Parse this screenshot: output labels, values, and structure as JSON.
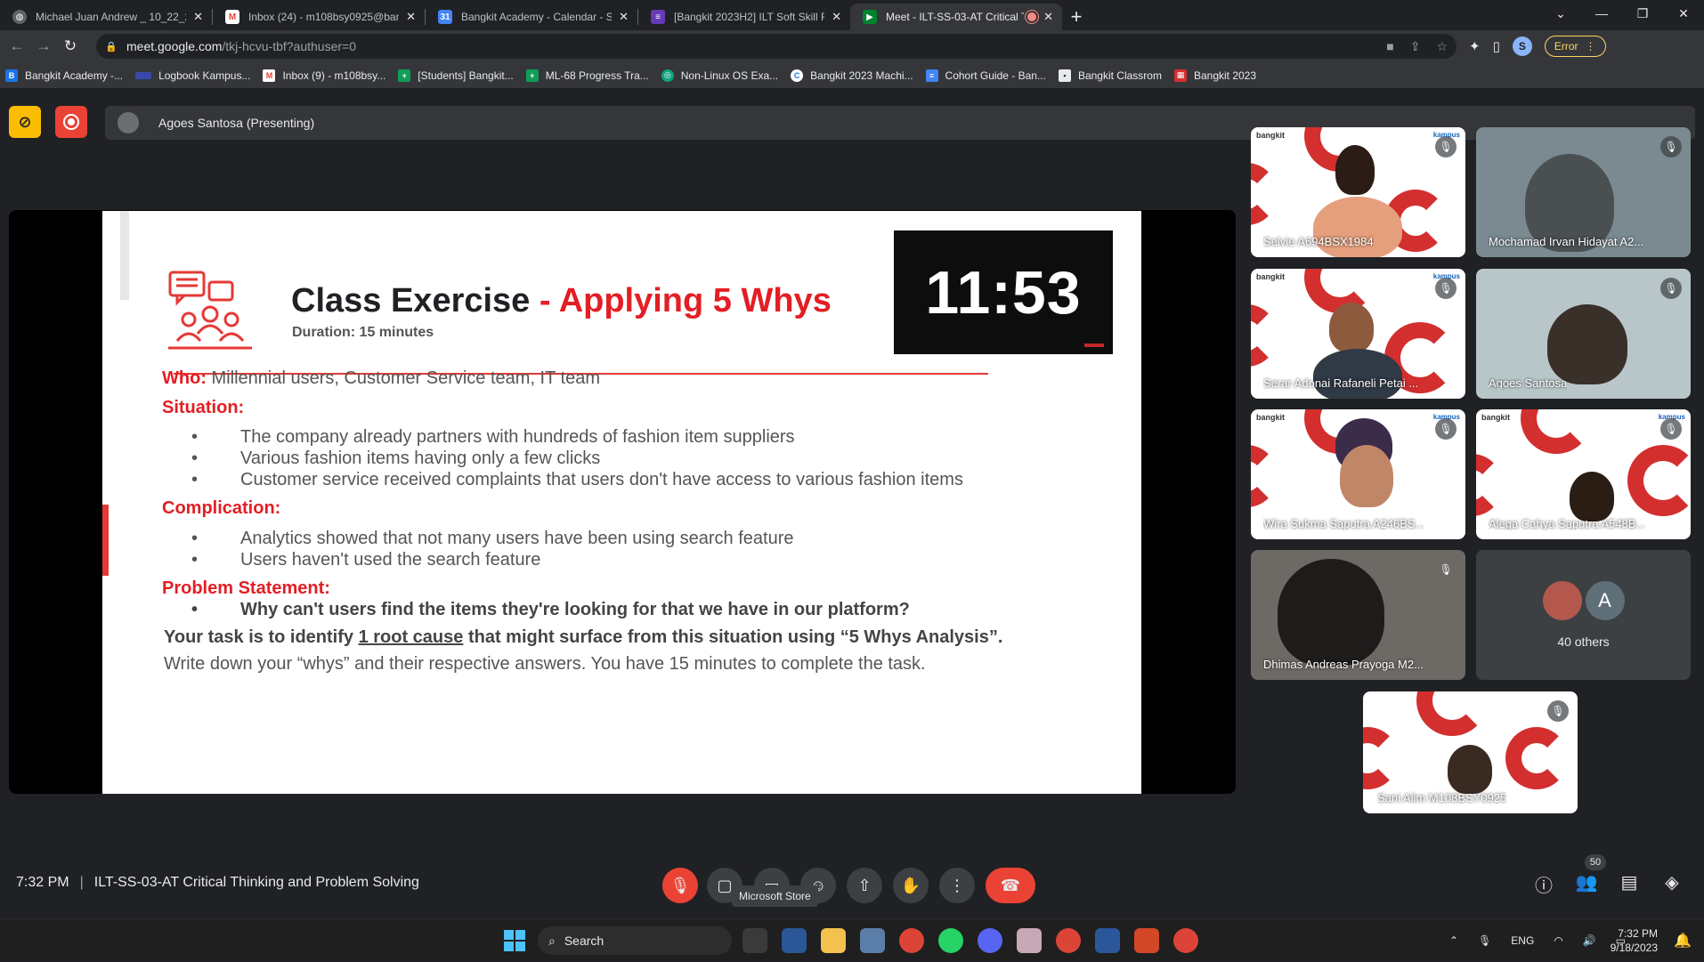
{
  "browser": {
    "tabs": [
      {
        "title": "Michael Juan Andrew _ 10_22_202",
        "favicon": "gray"
      },
      {
        "title": "Inbox (24) - m108bsy0925@bang",
        "favicon": "gmail"
      },
      {
        "title": "Bangkit Academy - Calendar - Se",
        "favicon": "calendar"
      },
      {
        "title": "[Bangkit 2023H2] ILT Soft Skill Fe",
        "favicon": "forms"
      },
      {
        "title": "Meet - ILT-SS-03-AT Critical T",
        "favicon": "meet"
      }
    ],
    "address": {
      "host": "meet.google.com",
      "path": "/tkj-hcvu-tbf?authuser=0"
    },
    "profile_initial": "S",
    "error_label": "Error",
    "bookmarks": [
      "Bangkit Academy -...",
      "Logbook Kampus...",
      "Inbox (9) - m108bsy...",
      "[Students] Bangkit...",
      "ML-68 Progress Tra...",
      "Non-Linux OS Exa...",
      "Bangkit 2023 Machi...",
      "Cohort Guide - Ban...",
      "Bangkit Classrom",
      "Bangkit 2023"
    ]
  },
  "meet": {
    "presenting_label": "Agoes Santosa (Presenting)",
    "slide": {
      "title_main": "Class Exercise",
      "title_accent": "- Applying 5 Whys",
      "duration": "Duration: 15 minutes",
      "timer": "11:53",
      "who_label": "Who:",
      "who_text": "Millennial users, Customer Service team, IT team",
      "situation_label": "Situation:",
      "situation_items": [
        "The company already partners with hundreds of fashion item suppliers",
        "Various fashion items having only a few clicks",
        "Customer service received complaints that users don't have access to various fashion items"
      ],
      "complication_label": "Complication:",
      "complication_items": [
        "Analytics showed that not many users have been using search feature",
        "Users haven't used the search feature"
      ],
      "problem_label": "Problem Statement:",
      "problem_item": "Why can't users find the items they're looking for that we have in our platform?",
      "task_pre": "Your task is to identify ",
      "task_link": "1 root cause",
      "task_post": " that might surface from this situation using “5 Whys Analysis”.",
      "write_down": "Write down your “whys” and their respective answers. You have 15 minutes to complete the task."
    },
    "participants": [
      "Selvie A694BSX1984",
      "Mochamad Irvan Hidayat A2...",
      "Serar Adonai Rafaneli Petai ...",
      "Agoes Santosa",
      "Wira Sukma Saputra A246BS...",
      "Alega Cahya Saputra A548B...",
      "Dhimas Andreas Prayoga M2...",
      "Sani Alim M108BSY0925"
    ],
    "others_label": "40 others",
    "others_initial": "A",
    "time": "7:32 PM",
    "meeting_name": "ILT-SS-03-AT Critical Thinking and Problem Solving",
    "tooltip": "Microsoft Store",
    "people_count": "50"
  },
  "taskbar": {
    "search_label": "Search",
    "lang": "ENG",
    "time": "7:32 PM",
    "date": "9/18/2023"
  }
}
